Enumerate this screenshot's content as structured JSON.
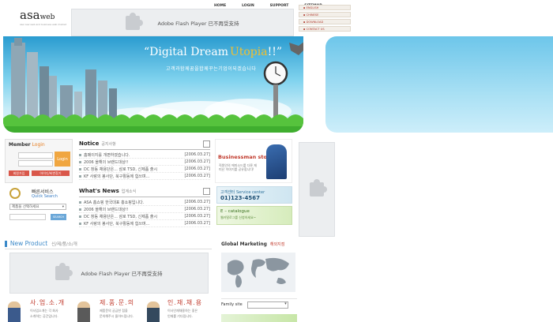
{
  "logo": {
    "main": "asa",
    "suffix": "web",
    "tagline": "asa new web and business web market"
  },
  "top_flash": {
    "label": "Adobe Flash Player 已不再受支持"
  },
  "top_nav": [
    "HOME",
    "LOGIN",
    "SUPPORT",
    "SITEMAP"
  ],
  "side_nav": [
    "▪ ENGLISH",
    "▪ CHINESE",
    "▪ DOWNLOAD",
    "▪ CONTACT US"
  ],
  "hero": {
    "headline": "“Digital Dream",
    "headline_accent": "Utopia",
    "headline_end": "!!”",
    "korean": "고객과함께꿈을합께꾸는기업이되겠습니다"
  },
  "login": {
    "title_prefix": "Member",
    "title_accent": "Login",
    "button": "Login",
    "join": "회원가입",
    "find": "아이디/비번찾기"
  },
  "quick_search": {
    "title": "빠른서비스",
    "subtitle": "Quick Search",
    "select_value": "제품을 선택하세요",
    "go": "SEARCH"
  },
  "notice": {
    "title": "Notice",
    "subtitle": "공지사항",
    "items": [
      {
        "text": "홈페이지를 개편하였습니다.",
        "date": "[2006.03.27]"
      },
      {
        "text": "2006 올해의 브랜드대상!!",
        "date": "[2006.03.27]"
      },
      {
        "text": "DC 창동 채용단은... 삼로 TSD, 신제품 출시",
        "date": "[2006.03.27]"
      },
      {
        "text": "KF 사랑의 봉사단, 북구활동에 힘쓰며...",
        "date": "[2006.03.27]"
      }
    ]
  },
  "whats_news": {
    "title": "What's News",
    "subtitle": "업계소식",
    "items": [
      {
        "text": "ASA 홈쇼핑 한국대표 홍쇼핑입니다.",
        "date": "[2006.03.27]"
      },
      {
        "text": "2006 올해의 브랜드대상!!",
        "date": "[2006.03.27]"
      },
      {
        "text": "DC 창동 채용단은... 삼로 TSD, 신제품 출시",
        "date": "[2006.03.27]"
      },
      {
        "text": "KF 사랑의 봉사단, 북구활동에 힘쓰며...",
        "date": "[2006.03.27]"
      }
    ]
  },
  "business": {
    "title": "Businessman story",
    "desc": "직원인의 에피소드를 다룬 재미난 이야기를 공유합니다!"
  },
  "service": {
    "title": "고객센터 Service center",
    "phone": "01)123-4567"
  },
  "catalogue": {
    "title": "E – catalogue",
    "desc": "웹카탈로그를 신청하세요~"
  },
  "new_product": {
    "title": "New Product",
    "subtitle": "신/제/품/소/개",
    "flash": "Adobe Flash Player 已不再受支持"
  },
  "global": {
    "title": "Global Marketing",
    "subtitle": "해외지점"
  },
  "family_site": {
    "label": "Family site"
  },
  "categories": [
    {
      "title": "사.업.소.개",
      "desc1": "이사업소개는 각 회사",
      "desc2": "소개하는 공간입니다."
    },
    {
      "title": "제.품.문.의",
      "desc1": "제품문의 궁금한 점을",
      "desc2": "문의해주시 돌아드립니다."
    },
    {
      "title": "인.재.채.용",
      "desc1": "이사인재채용하는 좋은",
      "desc2": "인재를 기다립니다."
    }
  ]
}
